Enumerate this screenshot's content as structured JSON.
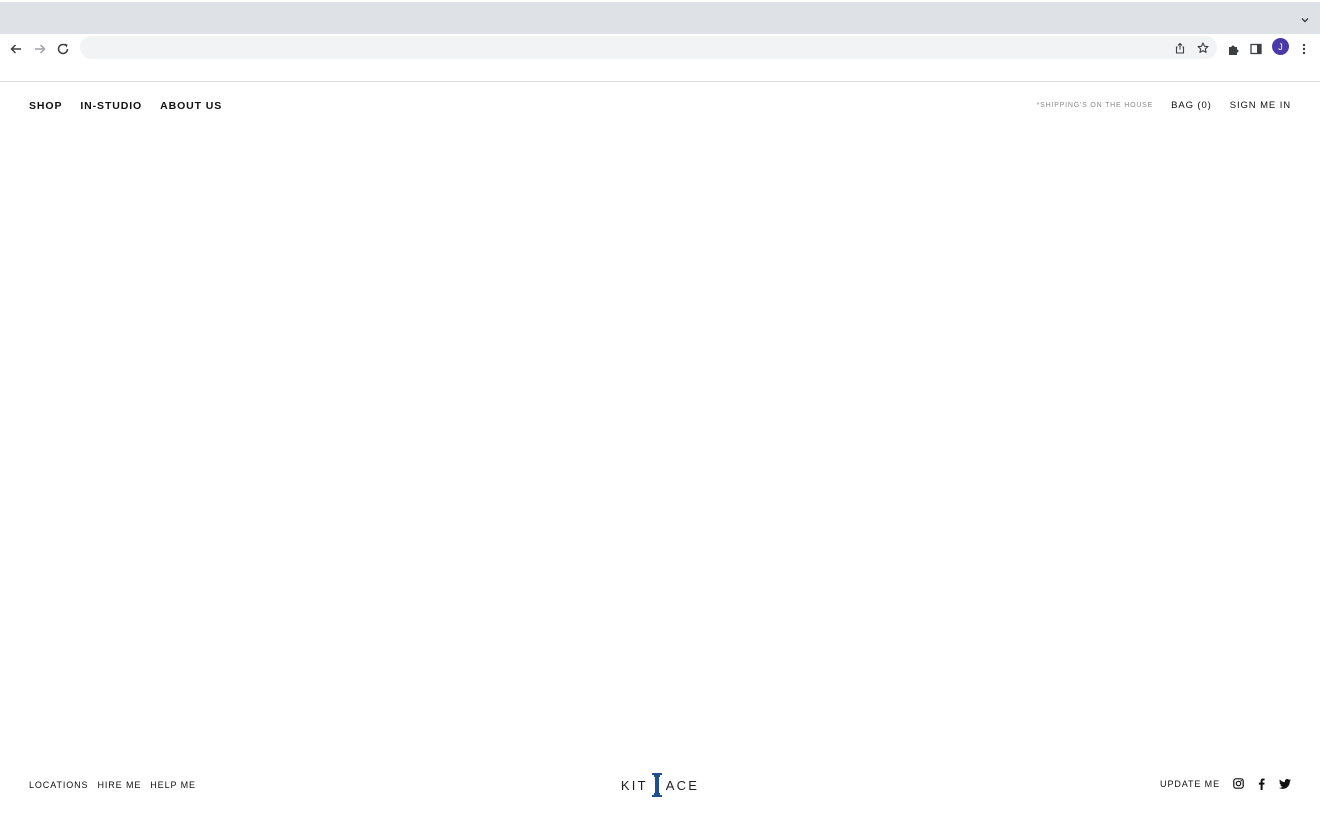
{
  "browser": {
    "profile_initial": "J",
    "address": ""
  },
  "header": {
    "nav_left": [
      "SHOP",
      "IN-STUDIO",
      "ABOUT US"
    ],
    "promo": "*SHIPPING'S ON THE HOUSE",
    "bag": "BAG (0)",
    "sign_in": "SIGN ME IN"
  },
  "footer": {
    "links": [
      "LOCATIONS",
      "HIRE ME",
      "HELP ME"
    ],
    "logo_left": "KIT",
    "logo_right": "ACE",
    "update": "UPDATE ME",
    "social_icons": [
      "instagram-icon",
      "facebook-icon",
      "twitter-icon"
    ]
  },
  "colors": {
    "tabstrip": "#dee1e6",
    "omnibox": "#f1f3f4",
    "avatar": "#4a3aa8",
    "logo_accent": "#1d4f91",
    "text": "#111111",
    "promo_text": "#8a8a8a"
  }
}
